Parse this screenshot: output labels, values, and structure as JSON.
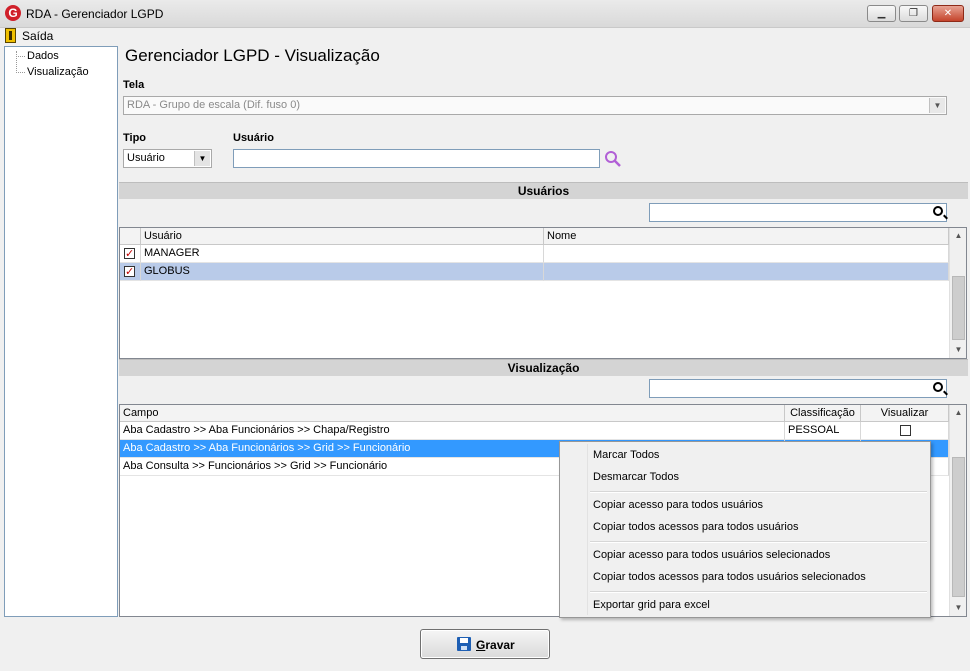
{
  "window": {
    "title": "RDA - Gerenciador LGPD",
    "logo_letter": "G",
    "minimize_glyph": "▁",
    "maximize_glyph": "❐",
    "close_glyph": "✕"
  },
  "menu": {
    "exit_label": "Saída"
  },
  "tree": {
    "items": [
      "Dados",
      "Visualização"
    ]
  },
  "main": {
    "title": "Gerenciador LGPD - Visualização",
    "tela": {
      "label": "Tela",
      "value": "RDA - Grupo de escala (Dif. fuso 0)"
    },
    "tipo": {
      "label": "Tipo",
      "value": "Usuário"
    },
    "usuario": {
      "label": "Usuário",
      "value": ""
    }
  },
  "users_section": {
    "title": "Usuários",
    "search_value": "",
    "columns": [
      "Usuário",
      "Nome"
    ],
    "rows": [
      {
        "checked": true,
        "usuario": "MANAGER",
        "nome": ""
      },
      {
        "checked": true,
        "usuario": "GLOBUS",
        "nome": ""
      }
    ]
  },
  "visual_section": {
    "title": "Visualização",
    "search_value": "",
    "columns": [
      "Campo",
      "Classificação",
      "Visualizar"
    ],
    "rows": [
      {
        "campo": "Aba Cadastro >> Aba Funcionários >> Chapa/Registro",
        "classificacao": "PESSOAL",
        "visualizar": false
      },
      {
        "campo": "Aba Cadastro >> Aba Funcionários >> Grid >> Funcionário",
        "classificacao": "",
        "visualizar": false
      },
      {
        "campo": "Aba Consulta >> Funcionários >> Grid >> Funcionário",
        "classificacao": "",
        "visualizar": false
      }
    ]
  },
  "context_menu": {
    "items": [
      "Marcar Todos",
      "Desmarcar Todos",
      "Copiar acesso para todos usuários",
      "Copiar todos acessos para todos usuários",
      "Copiar acesso para todos usuários selecionados",
      "Copiar todos acessos para todos usuários selecionados",
      "Exportar grid para excel"
    ]
  },
  "save_button": {
    "accel": "G",
    "rest": "ravar"
  },
  "colors": {
    "selection": "#3399ff",
    "selection_light": "#b9cbe9",
    "accent_search": "#b15fd6",
    "logo": "#d0202a"
  }
}
